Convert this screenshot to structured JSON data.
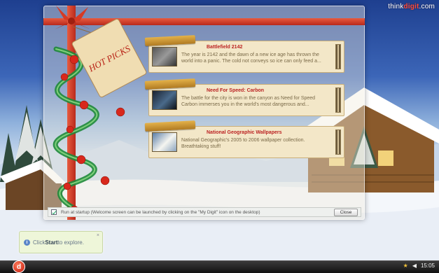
{
  "brand": {
    "prefix": "think",
    "highlight": "digit",
    "suffix": ".com"
  },
  "tag": {
    "label": "HOT PICKS"
  },
  "items": [
    {
      "title": "Battlefield 2142",
      "description": "The year is 2142 and the dawn of a new ice age has thrown the world into a panic. The cold not conveys so ice can only feed a...",
      "thumb": "soldiers-thumbnail"
    },
    {
      "title": "Need For Speed: Carbon",
      "description": "The battle for the city is won in the canyon as Need for Speed Carbon immerses you in the world's most dangerous and...",
      "thumb": "car-thumbnail"
    },
    {
      "title": "National Geographic Wallpapers",
      "description": "National Geographic's 2005 to 2006 wallpaper collection. Breathtaking stuff!",
      "thumb": "polar-bear-thumbnail"
    }
  ],
  "startup": {
    "label": "Run at startup (Welcome screen can be launched by clicking on the \"My Digit\" icon on the desktop)",
    "checked": true
  },
  "close_button": "Close",
  "hint": {
    "prefix": "Click ",
    "bold": "Start",
    "suffix": " to explore.",
    "close": "×"
  },
  "taskbar": {
    "start_glyph": "d",
    "clock": "15:05"
  }
}
